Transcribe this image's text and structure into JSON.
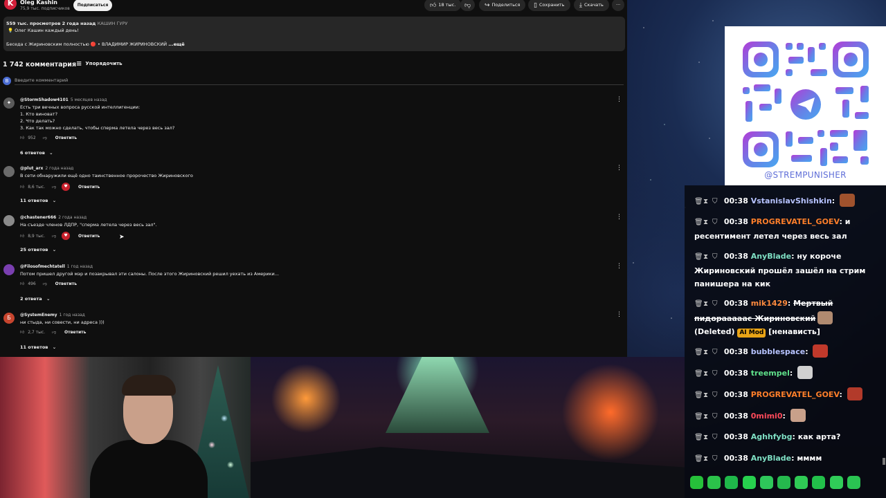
{
  "youtube": {
    "channel": {
      "logo_letter": "K",
      "name": "Oleg Kashin",
      "subscribers": "75,9 тыс. подписчиков",
      "subscribe_label": "Подписаться"
    },
    "actions": {
      "likes": "18 тыс.",
      "share": "Поделиться",
      "save": "Сохранить",
      "download": "Скачать"
    },
    "description": {
      "views": "559 тыс. просмотров",
      "age": "2 года назад",
      "tag": "КАШИН ГУРУ",
      "line1": "💡 Олег Кашин каждый день!",
      "line2": "Беседа с Жириновским полностью 🔴 • ВЛАДИМИР ЖИРИНОВСКИЙ",
      "more": "...ещё"
    },
    "comments_count": "1 742 комментария",
    "sort_label": "Упорядочить",
    "my_avatar_letter": "В",
    "input_placeholder": "Введите комментарий",
    "reply_label": "Ответить",
    "comments": [
      {
        "author": "@StormShadow4101",
        "time": "5 месяцев назад",
        "avatar_letter": "✦",
        "avatar_color": "#5a5a5a",
        "text": "Есть три вечных вопроса русской интеллигенции:\n1. Кто виноват?\n2. Что делать?\n3. Как так можно сделать, чтобы сперма летела через весь зал?",
        "likes": "952",
        "hearted": false,
        "replies": "6 ответов"
      },
      {
        "author": "@plut_arx",
        "time": "2 года назад",
        "avatar_letter": "",
        "avatar_color": "#6b6b6b",
        "text": "В сети обнаружили ещё одно таинственное пророчество Жириновского",
        "likes": "8,6 тыс.",
        "hearted": true,
        "replies": "11 ответов"
      },
      {
        "author": "@chastener666",
        "time": "2 года назад",
        "avatar_letter": "",
        "avatar_color": "#8a8a8a",
        "text": "На съезде членов ЛДПР, \"сперма летела через весь зал\".",
        "likes": "8,9 тыс.",
        "hearted": true,
        "replies": "25 ответов"
      },
      {
        "author": "@Filosofmechtatell",
        "time": "1 год назад",
        "avatar_letter": "",
        "avatar_color": "#7a3fb0",
        "text": "Потом пришел другой мэр и позакрывал эти салоны. После этого Жириновский решил уехать из Америки...",
        "likes": "496",
        "hearted": false,
        "replies": "2 ответа"
      },
      {
        "author": "@SystemEnemy",
        "time": "1 год назад",
        "avatar_letter": "Б",
        "avatar_color": "#c7452e",
        "text": "ни стыда, ни совести, ни адреса )))",
        "likes": "2,7 тыс.",
        "hearted": false,
        "replies": "11 ответов"
      }
    ]
  },
  "qr": {
    "handle": "@STREMPUNISHER"
  },
  "chat": {
    "messages": [
      {
        "time": "00:38",
        "user": "VstanislavShishkin",
        "color": "#b7c3ff",
        "text": "",
        "emote": "#a0522d"
      },
      {
        "time": "00:38",
        "user": "PROGREVATEL_GOEV",
        "color": "#ff7f2a",
        "text": "и ресентимент летел через весь зал"
      },
      {
        "time": "00:38",
        "user": "AnyBlade",
        "color": "#7fe0c4",
        "text": "ну короче Жириновский прошёл зашёл на стрим панишера на кик"
      },
      {
        "time": "00:38",
        "user": "mik1429",
        "color": "#ff8a3d",
        "text": "Мертвый пидорааааас Жириновский",
        "deleted": "(Deleted)",
        "badge": "AI Mod",
        "tail": "[ненависть]",
        "emote": "#b08a70"
      },
      {
        "time": "00:38",
        "user": "bubblespace",
        "color": "#b7c3ff",
        "text": "",
        "emote": "#c0392b"
      },
      {
        "time": "00:38",
        "user": "treempel",
        "color": "#5fe08a",
        "text": "",
        "emote": "#d0d0d0"
      },
      {
        "time": "00:38",
        "user": "PROGREVATEL_GOEV",
        "color": "#ff7f2a",
        "text": "",
        "emote": "#b23a2a"
      },
      {
        "time": "00:38",
        "user": "0mimi0",
        "color": "#ff4a5a",
        "text": "",
        "emote": "#c8a08a"
      },
      {
        "time": "00:38",
        "user": "Aghhfybg",
        "color": "#7fe0c4",
        "text": "как арта?"
      },
      {
        "time": "00:38",
        "user": "AnyBlade",
        "color": "#7fe0c4",
        "text": "мммм"
      }
    ],
    "emote_bar_colors": [
      "#26c03a",
      "#2bc24a",
      "#1fb84a",
      "#27d04e",
      "#2ec75a",
      "#25b94d",
      "#2fcb55",
      "#22c04a",
      "#30cc58",
      "#2ac452"
    ]
  },
  "colors": {
    "bg_youtube": "#0f0f0f",
    "chat_bg": "#0a0c14",
    "accent_red": "#d2203a"
  }
}
